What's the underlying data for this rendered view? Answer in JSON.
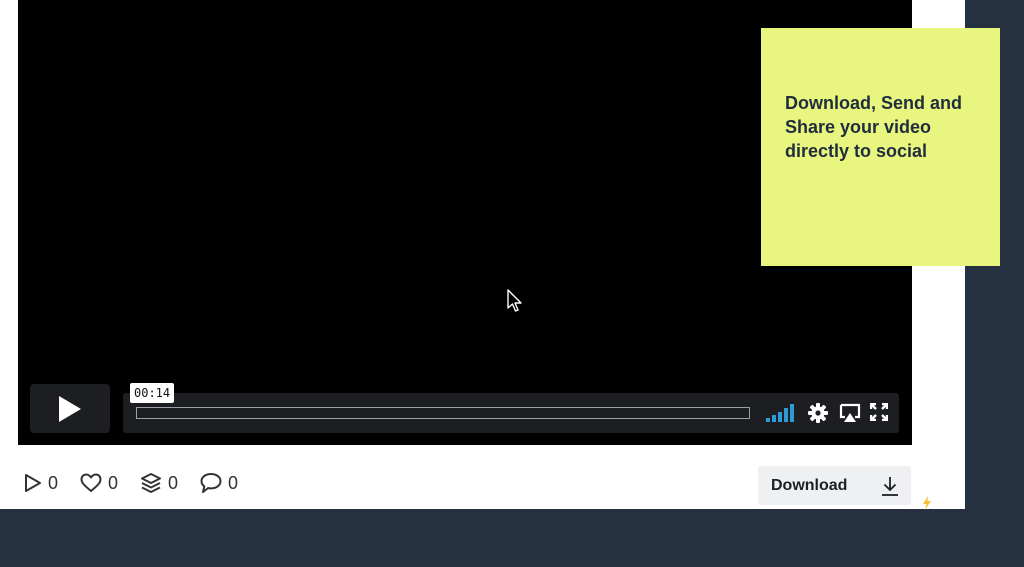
{
  "player": {
    "timecode": "00:14",
    "icons": {
      "play": "play-icon",
      "volume": "volume-bars-icon",
      "settings": "gear-icon",
      "airplay": "airplay-icon",
      "fullscreen": "fullscreen-icon",
      "cursor": "mouse-pointer-icon"
    }
  },
  "stats": {
    "plays": "0",
    "likes": "0",
    "collections": "0",
    "comments": "0"
  },
  "actions": {
    "download_label": "Download"
  },
  "callout": {
    "text": "Download, Send and Share your video directly to social"
  },
  "colors": {
    "background": "#253140",
    "callout": "#e8f57e",
    "volume_accent": "#2f9bd6"
  }
}
